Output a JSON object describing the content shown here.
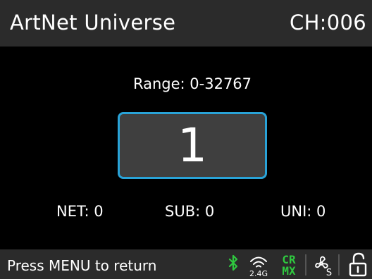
{
  "header": {
    "title": "ArtNet Universe",
    "channel": "CH:006"
  },
  "main": {
    "range_label": "Range: 0-32767",
    "value": "1",
    "net_label": "NET: 0",
    "sub_label": "SUB: 0",
    "uni_label": "UNI: 0"
  },
  "footer": {
    "hint": "Press MENU to return",
    "icons": [
      {
        "name": "bluetooth-icon",
        "color": "#2fc83f"
      },
      {
        "name": "wifi-2.4g-icon",
        "text": "2.4G",
        "color": "#ffffff"
      },
      {
        "name": "crmx-icon",
        "text_top": "CR",
        "text_bottom": "MX",
        "color": "#2fc83f"
      },
      {
        "name": "fan-icon",
        "text": "S",
        "color": "#ffffff"
      },
      {
        "name": "unlock-icon",
        "color": "#ffffff"
      }
    ]
  },
  "colors": {
    "header_bg": "#2b2b2b",
    "screen_bg": "#000000",
    "value_box_bg": "#3f3f3f",
    "value_box_border": "#29a3d8",
    "accent_green": "#2fc83f"
  }
}
